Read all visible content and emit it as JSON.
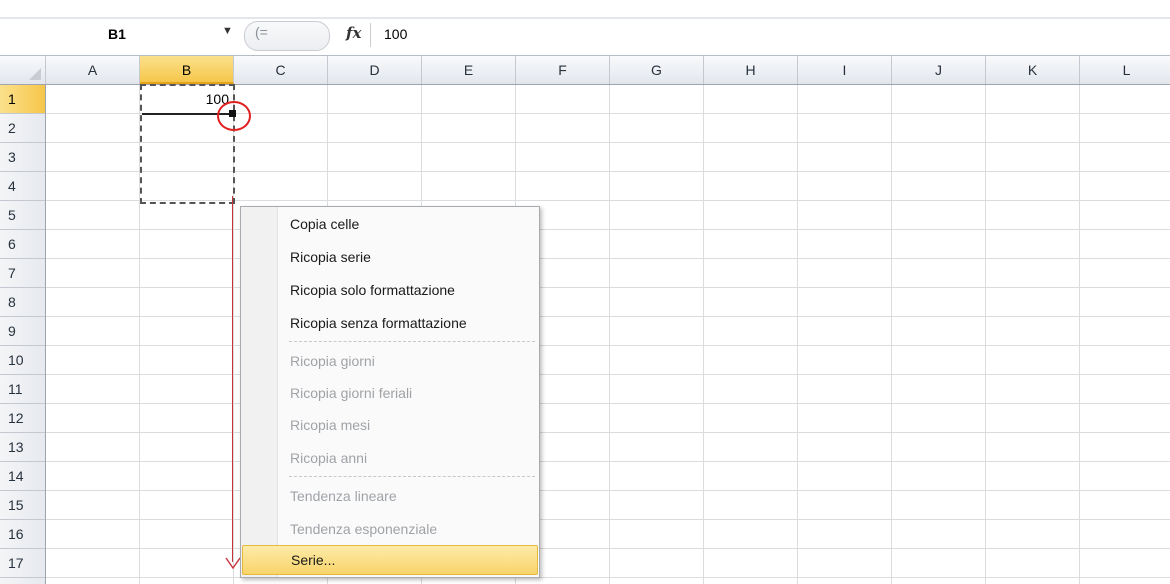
{
  "formula_bar": {
    "name_box": "B1",
    "name_box_arrow": "▼",
    "pill_glyph": "(=",
    "fx_label": "fx",
    "formula": "100"
  },
  "columns": [
    "A",
    "B",
    "C",
    "D",
    "E",
    "F",
    "G",
    "H",
    "I",
    "J",
    "K",
    "L"
  ],
  "rows": [
    "1",
    "2",
    "3",
    "4",
    "5",
    "6",
    "7",
    "8",
    "9",
    "10",
    "11",
    "12",
    "13",
    "14",
    "15",
    "16",
    "17"
  ],
  "selected_column": "B",
  "selected_row": "1",
  "cells": {
    "B1": "100"
  },
  "context_menu": {
    "items": [
      {
        "label": "Copia celle",
        "enabled": true
      },
      {
        "label": "Ricopia serie",
        "enabled": true
      },
      {
        "label": "Ricopia solo formattazione",
        "enabled": true
      },
      {
        "label": "Ricopia senza formattazione",
        "enabled": true
      },
      {
        "label": "Ricopia giorni",
        "enabled": false
      },
      {
        "label": "Ricopia giorni feriali",
        "enabled": false
      },
      {
        "label": "Ricopia mesi",
        "enabled": false
      },
      {
        "label": "Ricopia anni",
        "enabled": false
      },
      {
        "label": "Tendenza lineare",
        "enabled": false
      },
      {
        "label": "Tendenza esponenziale",
        "enabled": false
      },
      {
        "label": "Serie...",
        "enabled": true,
        "highlighted": true
      }
    ]
  },
  "colors": {
    "selection_accent": "#f6c64a",
    "annotation_red": "#e22020",
    "menu_highlight": "#f8d46a"
  }
}
